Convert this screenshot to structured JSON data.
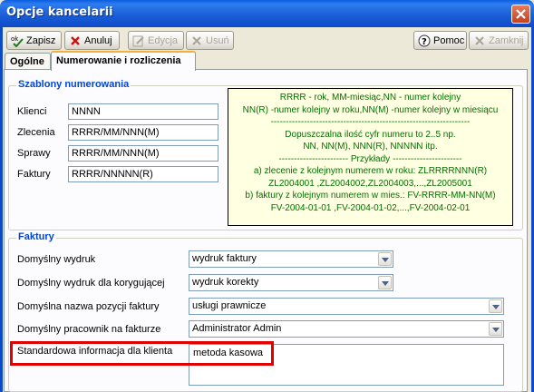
{
  "window": {
    "title": "Opcje kancelarii"
  },
  "toolbar": {
    "save_label": "Zapisz",
    "cancel_label": "Anuluj",
    "edit_label": "Edycja",
    "delete_label": "Usuń",
    "help_label": "Pomoc",
    "close_label": "Zamknij"
  },
  "tabs": [
    {
      "label": "Ogólne",
      "active": false
    },
    {
      "label": "Numerowanie i rozliczenia",
      "active": true
    }
  ],
  "numbering": {
    "title": "Szablony numerowania",
    "fields": [
      {
        "label": "Klienci",
        "value": "NNNN"
      },
      {
        "label": "Zlecenia",
        "value": "RRRR/MM/NNN(M)"
      },
      {
        "label": "Sprawy",
        "value": "RRRR/MM/NNN(M)"
      },
      {
        "label": "Faktury",
        "value": "RRRR/NNNNN(R)"
      }
    ],
    "help_lines": [
      "RRRR - rok, MM-miesiąc,NN - numer kolejny",
      "NN(R) -numer kolejny w roku,NN(M) -numer kolejny w miesiącu",
      "------------------------------------------------------------------",
      "Dopuszczalna ilość cyfr numeru to 2..5 np.",
      "NN, NN(M), NNN(R), NNNNN itp.",
      "----------------------- Przykłady -----------------------",
      "a) zlecenie z kolejnym numerem w roku: ZLRRRRNNN(R)",
      "ZL2004001 ,ZL2004002,ZL2004003,...,ZL2005001",
      "b) faktury z kolejnym numerem w mies.: FV-RRRR-MM-NN(M)",
      "FV-2004-01-01 ,FV-2004-01-02,...,FV-2004-02-01"
    ]
  },
  "invoices": {
    "title": "Faktury",
    "default_print_label": "Domyślny wydruk",
    "default_print_value": "wydruk faktury",
    "corrective_print_label": "Domyślny wydruk dla korygującej",
    "corrective_print_value": "wydruk korekty",
    "item_name_label": "Domyślna nazwa pozycji faktury",
    "item_name_value": "usługi prawnicze",
    "employee_label": "Domyślny pracownik na fakturze",
    "employee_value": "Administrator Admin",
    "client_info_label": "Standardowa informacja dla klienta",
    "client_info_value": "metoda kasowa"
  },
  "colors": {
    "titlebar": "#1c5fd8",
    "group_title": "#0046d5",
    "help_text": "#007000",
    "help_background": "#ffffe1",
    "highlight": "#e00000"
  }
}
